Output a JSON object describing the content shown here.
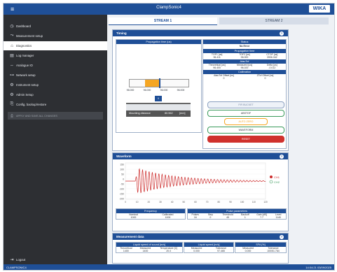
{
  "app": {
    "title": "ClampSonic4",
    "logo": "WIKA",
    "menu_icon": "hamburger-icon"
  },
  "sidebar": {
    "items": [
      {
        "label": "Dashboard",
        "icon": "dashboard-icon",
        "glyph": "◷"
      },
      {
        "label": "Measurement setup",
        "icon": "measurement-icon",
        "glyph": "⤳"
      },
      {
        "label": "Diagnostics",
        "icon": "diagnostics-icon",
        "glyph": "⌂",
        "active": true
      },
      {
        "label": "Log manager",
        "icon": "log-icon",
        "glyph": "▤"
      },
      {
        "label": "Analogue IO",
        "icon": "io-icon",
        "glyph": "⇔"
      },
      {
        "label": "Network setup",
        "icon": "network-icon",
        "glyph": "⊶"
      },
      {
        "label": "Instrument setup",
        "icon": "instrument-icon",
        "glyph": "⚙"
      },
      {
        "label": "Admin Setup",
        "icon": "admin-icon",
        "glyph": "⚙"
      },
      {
        "label": "Config. backup/restore",
        "icon": "backup-icon",
        "glyph": "⎘"
      }
    ],
    "disabled_button": "APPLY AND SAVE ALL CHANGES",
    "logout": "Logout"
  },
  "tabs": [
    "STREAM 1",
    "STREAM 2"
  ],
  "timing": {
    "title": "Timing",
    "propagation_title": "Propagation time (us)",
    "bar_labels": [
      "96.000",
      "96.000",
      "96.000",
      "96.000"
    ],
    "marker_value": "0",
    "mounting_label": "Mounting distance",
    "mounting_value": "80.962",
    "mounting_unit": "[mm]",
    "status": {
      "title": "Status",
      "value": "No Error"
    },
    "prop_table": {
      "title": "Propagation time",
      "headers": [
        "TOF1 [us]",
        "TOF2 [us]",
        "CTOF [us]"
      ],
      "values": [
        "96.411",
        "96.000",
        "3906.342"
      ]
    },
    "deltatof": {
      "title": "ΔtauTof",
      "headers": [
        "Theoretical [us]",
        "Measured [us]",
        "Delta [us]"
      ],
      "values": [
        "96.400",
        "96.100",
        "-0.012"
      ]
    },
    "calibration": {
      "title": "Calibration",
      "headers": [
        "ΔtauTof Offset [ns]",
        "ZTof Offset [ns]"
      ],
      "values": [
        "0",
        "0"
      ]
    },
    "buttons": [
      "FIR BUCKET",
      "ABSTOF",
      "AUTO ZERO",
      "WAVEFORM",
      "RESET"
    ]
  },
  "waveform": {
    "title": "Waveform",
    "y_ticks": [
      "150",
      "100",
      "50",
      "0",
      "-50",
      "-100",
      "-150",
      "-200"
    ],
    "x_ticks": [
      "0",
      "10",
      "20",
      "30",
      "40",
      "50",
      "60",
      "70",
      "80",
      "90",
      "100",
      "110",
      "120"
    ],
    "legend": [
      "CH1",
      "CH2"
    ],
    "freq": {
      "title": "Frequency",
      "headers": [
        "Nominal",
        "Calibrated"
      ],
      "values": [
        "1000",
        "1000"
      ]
    },
    "pulse": {
      "title": "Pulse parameters",
      "headers": [
        "Pulses",
        "Step",
        "Threshold",
        "Backoff",
        "Gain [dB]",
        "Level"
      ],
      "values": [
        "16",
        "0",
        "45",
        "1",
        "7.7",
        "1140"
      ]
    }
  },
  "measurement": {
    "title": "Measurement data",
    "groups": [
      {
        "title": "Liquid speed of sound [m/s]",
        "headers": [
          "Theoretical",
          "Measured",
          "Temperature [C]"
        ],
        "values": [
          "1400",
          "1400",
          "20.0"
        ]
      },
      {
        "title": "Liquid speed [m/s]",
        "headers": [
          "Measured",
          "Tolerance"
        ],
        "values": [
          "0.000",
          "97.465"
        ]
      },
      {
        "title": "SFA [%]",
        "headers": [
          "Measured",
          "Tolerance"
        ],
        "values": [
          "0.000",
          "100/51.764"
        ]
      }
    ]
  },
  "statusbar": {
    "left": "CLAMPSONIC4",
    "right": "14:04:21   03/09/2025"
  },
  "colors": {
    "primary": "#1f4f97",
    "sidebar": "#2d2f33",
    "orange": "#f5a623",
    "red": "#d0312d",
    "green": "#3a9a5b",
    "wave": "#cc2a2a"
  }
}
